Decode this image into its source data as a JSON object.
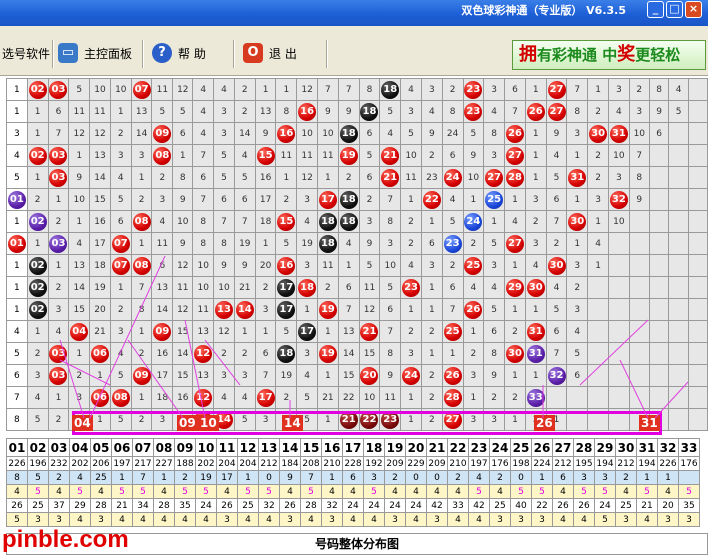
{
  "window": {
    "title": "双色球彩神通（专业版） V6.3.5",
    "min": "_",
    "max": "□",
    "close": "×"
  },
  "toolbar": {
    "btn1": "选号软件",
    "btn2": "主控面板",
    "btn3": "帮  助",
    "btn3_icon": "?",
    "btn4": "退  出",
    "btn4_icon": "O"
  },
  "banner": {
    "a": "拥",
    "b": "有彩神通",
    "c": "中",
    "d": "奖",
    "e": "更轻松"
  },
  "colors": {
    "red_ball": "#d40000",
    "black_ball": "#111111",
    "blue_ball": "#1a46d8",
    "purple_ball": "#5a1ea8",
    "magenta": "#e000e0"
  },
  "grid_rows": [
    "1 02r 03r 5 10 10 07r 11 12 4 4 2 1 1 12 7 7 8 18k 4 3 2 23r 3 6 1 27r 7 1 3 2 8 4",
    "1 1 6 11 11 1 13 5 5 4 3 2 13 8 16r 9 9 18k 5 3 4 8 23r 4 7 26r 27r 8 2 4 3 9 5",
    "3 1 7 12 12 2 14 09r 6 4 3 14 9 16r 10 10 18k 6 4 5 9 24 5 8 26r 1 9 3 30r 31r 10 6",
    "4 02r 03r 1 13 3 3 08r 1 7 5 4 15r 11 11 11 19r 5 21r 10 2 6 9 3 27r 1 4 1 2 10 7",
    "5 1 03r 9 14 4 1 2 8 6 5 5 16 1 12 1 2 6 21r 11 23 24r 10 27r 28r 1 5 31r 2 3 8",
    "01p 2 1 10 15 5 2 3 9 7 6 6 17 2 3 17r 18k 2 7 1 22r 4 1 25b 1 3 6 1 3 32r 9",
    "1 02p 2 1 16 6 08r 4 10 8 7 7 18 15r 4 18k 18k 3 8 2 1 5 24b 1 4 2 7 30r 1 10",
    "01r 1 03p 4 17 07r 1 11 9 8 8 19 1 5 19 18k 4 9 3 2 6 23b 2 5 27r 3 2 1 4",
    "1 02k 1 13 18 07r 08r 6 12 10 9 9 20 16r 3 11 1 5 10 4 3 2 25r 3 1 4 30r 3 1",
    "1 02k 2 14 19 1 7 13 11 10 10 21 2 17k 18r 2 6 11 5 23r 1 6 4 4 29r 30r 4 2",
    "1 02k 3 15 20 2 8 14 12 11 13r 14r 3 17k 1 19r 7 12 6 1 1 7 26r 5 1 1 5 3",
    "4 1 4 04r 21 3 1 09r 15 13 12 1 1 5 17k 1 13 21r 7 2 2 25r 1 6 2 31r 6 4",
    "5 2 03r 1 06r 4 2 16 14 12r 2 2 6 18k 3 19r 14 15 8 3 1 1 2 8 30r 31p 7 5",
    "6 3 03r 2 1 5 09r 17 15 13 3 3 7 19 4 1 15 20r 9 24r 2 26r 3 9 1 1 32p 6",
    "7 4 1 3 06r 08r 1 18 16 12r 4 4 17r 2 5 21 22 10 11 1 2 28r 1 2 2 33p",
    "8 5 2 4 1 5 2 3 17 13r 14r 5 3 6 5 1 21d 22d 23d 1 2 27r 3 3 1 2 1"
  ],
  "prediction": {
    "n1": "04",
    "n2": "09",
    "n3": "10",
    "n4": "14",
    "n5": "26",
    "n6": "31"
  },
  "stats": {
    "numbers": [
      "01",
      "02",
      "03",
      "04",
      "05",
      "06",
      "07",
      "08",
      "09",
      "10",
      "11",
      "12",
      "13",
      "14",
      "15",
      "16",
      "17",
      "18",
      "19",
      "20",
      "21",
      "22",
      "23",
      "24",
      "25",
      "26",
      "27",
      "28",
      "29",
      "30",
      "31",
      "32",
      "33"
    ],
    "row1": [
      "226",
      "196",
      "232",
      "202",
      "206",
      "197",
      "217",
      "227",
      "188",
      "202",
      "204",
      "204",
      "212",
      "184",
      "208",
      "210",
      "228",
      "192",
      "209",
      "229",
      "209",
      "210",
      "197",
      "176",
      "198",
      "224",
      "212",
      "195",
      "194",
      "212",
      "194",
      "226",
      "176"
    ],
    "row2": [
      "8",
      "5",
      "2",
      "4",
      "25",
      "1",
      "7",
      "1",
      "2",
      "19",
      "17",
      "1",
      "0",
      "9",
      "7",
      "1",
      "6",
      "3",
      "2",
      "0",
      "0",
      "2",
      "4",
      "2",
      "0",
      "1",
      "6",
      "3",
      "3",
      "2",
      "1",
      "1"
    ],
    "row3": [
      "4",
      "5",
      "4",
      "5",
      "4",
      "5",
      "5",
      "4",
      "5",
      "5",
      "4",
      "5",
      "5",
      "4",
      "5",
      "4",
      "4",
      "5",
      "4",
      "4",
      "4",
      "4",
      "5",
      "4",
      "5",
      "5",
      "4",
      "5",
      "5",
      "4",
      "5",
      "4",
      "5"
    ],
    "row4": [
      "26",
      "25",
      "37",
      "29",
      "28",
      "21",
      "34",
      "28",
      "35",
      "24",
      "26",
      "25",
      "32",
      "26",
      "28",
      "32",
      "24",
      "24",
      "24",
      "24",
      "42",
      "33",
      "42",
      "25",
      "40",
      "22",
      "26",
      "26",
      "24",
      "25",
      "21",
      "20",
      "35"
    ],
    "row5": [
      "5",
      "3",
      "3",
      "4",
      "3",
      "4",
      "4",
      "4",
      "4",
      "4",
      "3",
      "4",
      "4",
      "3",
      "4",
      "3",
      "4",
      "4",
      "3",
      "4",
      "3",
      "4",
      "4",
      "3",
      "3",
      "3",
      "4",
      "4",
      "5",
      "3",
      "4",
      "3",
      "3"
    ]
  },
  "footer": "号码整体分布图",
  "watermark": "pinble.com"
}
